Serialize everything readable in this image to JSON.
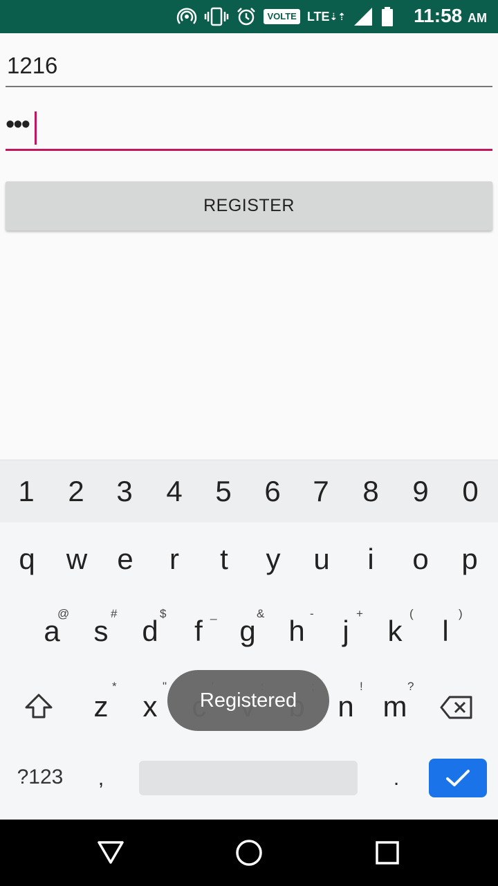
{
  "status_bar": {
    "time": "11:58",
    "ampm": "AM",
    "volte": "VOLTE",
    "network": "LTE",
    "icons": [
      "hotspot-icon",
      "vibrate-icon",
      "alarm-icon",
      "volte-icon",
      "lte-icon",
      "signal-icon",
      "battery-icon"
    ]
  },
  "form": {
    "field1_value": "1216",
    "field2_value": "•••",
    "register_label": "REGISTER"
  },
  "keyboard": {
    "numbers": [
      "1",
      "2",
      "3",
      "4",
      "5",
      "6",
      "7",
      "8",
      "9",
      "0"
    ],
    "row1": [
      "q",
      "w",
      "e",
      "r",
      "t",
      "y",
      "u",
      "i",
      "o",
      "p"
    ],
    "row2": [
      "a",
      "s",
      "d",
      "f",
      "g",
      "h",
      "j",
      "k",
      "l"
    ],
    "row2_hints": [
      "@",
      "#",
      "$",
      "_",
      "&",
      "-",
      "+",
      "(",
      ")"
    ],
    "row3": [
      "z",
      "x",
      "c",
      "v",
      "b",
      "n",
      "m"
    ],
    "row3_hints": [
      "*",
      "\"",
      "'",
      ":",
      ";",
      "!",
      "?"
    ],
    "symbols_label": "?123",
    "comma_label": ",",
    "period_label": ".",
    "accent_color": "#1a73e8"
  },
  "toast": {
    "message": "Registered"
  },
  "nav": {
    "icons": [
      "back-triangle-icon",
      "home-circle-icon",
      "recents-square-icon"
    ]
  }
}
